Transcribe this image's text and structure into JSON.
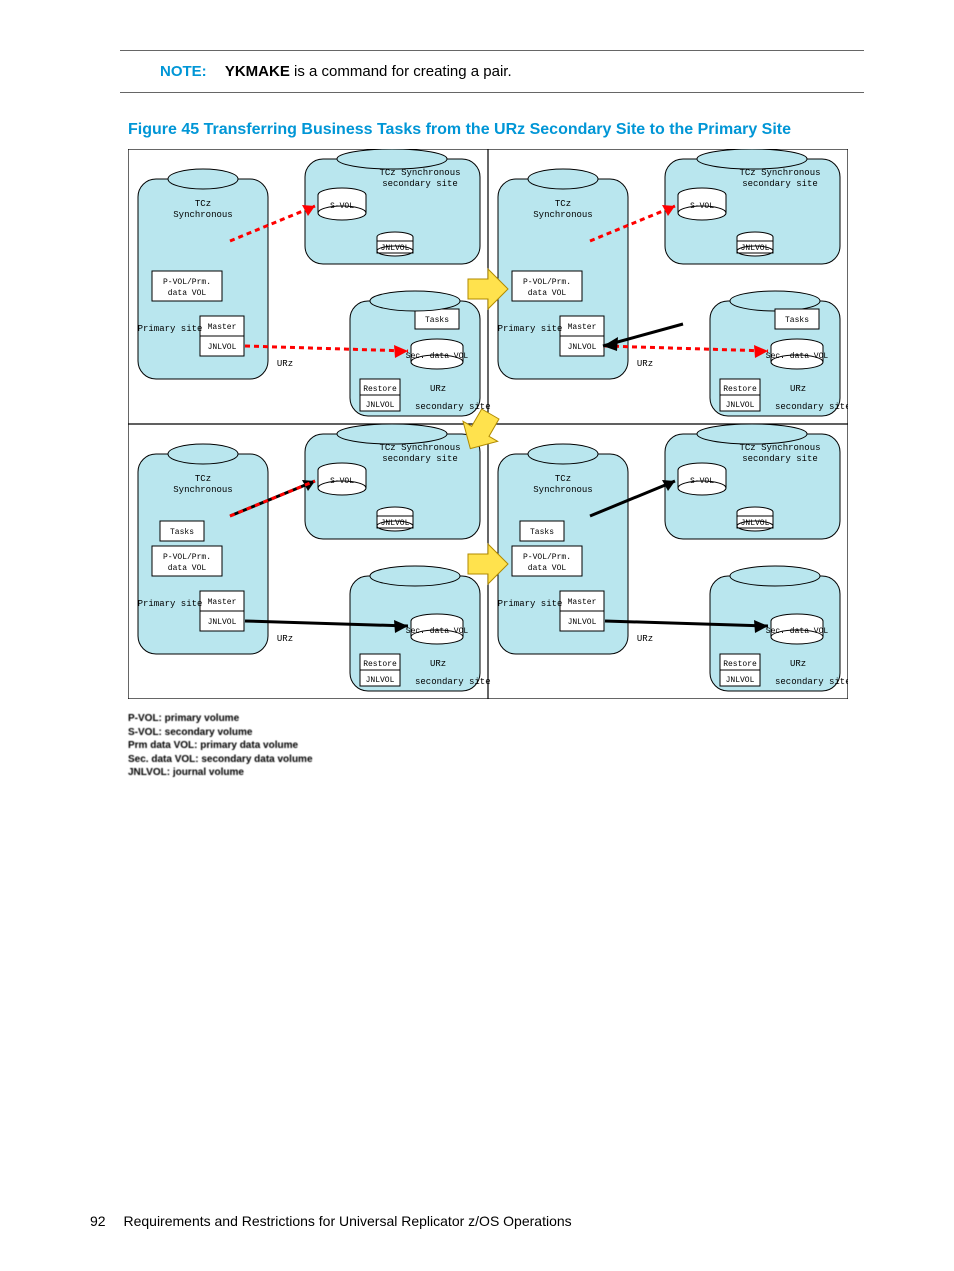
{
  "note": {
    "label": "NOTE:",
    "bold": "YKMAKE",
    "rest": " is a command for creating a pair."
  },
  "figure": {
    "caption": "Figure 45 Transferring Business Tasks from the URz Secondary Site to the Primary Site"
  },
  "diagram": {
    "tcz_sync": "TCz\nSynchronous",
    "tcz_sync_site": "TCz Synchronous\nsecondary site",
    "svol": "S-VOL",
    "jnlvol": "JNLVOL",
    "pvol_prm": "P-VOL/Prm.\ndata VOL",
    "primary_site": "Primary site",
    "master": "Master",
    "urz": "URz",
    "tasks": "Tasks",
    "sec_data_vol": "Sec. data VOL",
    "restore": "Restore",
    "urz_secondary_site": "URz\nsecondary site"
  },
  "legend": {
    "l1": "P-VOL: primary volume",
    "l2": "S-VOL: secondary volume",
    "l3": "Prm data VOL: primary data volume",
    "l4": "Sec. data VOL: secondary data volume",
    "l5": "JNLVOL: journal volume"
  },
  "footer": {
    "page": "92",
    "title": "Requirements and Restrictions for Universal Replicator z/OS Operations"
  }
}
